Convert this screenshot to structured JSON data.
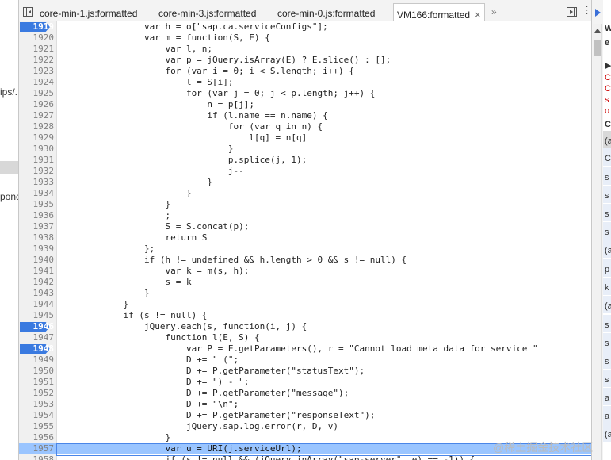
{
  "navigator": {
    "fragments": [
      "ips/.",
      "pone"
    ]
  },
  "tabs": [
    {
      "label": "core-min-1.js:formatted",
      "active": false
    },
    {
      "label": "core-min-3.js:formatted",
      "active": false
    },
    {
      "label": "core-min-0.js:formatted",
      "active": false
    },
    {
      "label": "VM166:formatted",
      "active": true
    }
  ],
  "tab_close_glyph": "×",
  "tab_overflow_glyph": "»",
  "sidebar_more_glyph": "⋮",
  "editor": {
    "breakpoint_lines": [
      "1919",
      "1946",
      "1948"
    ],
    "current_line": "1957",
    "lines": [
      {
        "n": "1919",
        "code": "                var h = o[\"sap.ca.serviceConfigs\"];"
      },
      {
        "n": "1920",
        "code": "                var m = function(S, E) {"
      },
      {
        "n": "1921",
        "code": "                    var l, n;"
      },
      {
        "n": "1922",
        "code": "                    var p = jQuery.isArray(E) ? E.slice() : [];"
      },
      {
        "n": "1923",
        "code": "                    for (var i = 0; i < S.length; i++) {"
      },
      {
        "n": "1924",
        "code": "                        l = S[i];"
      },
      {
        "n": "1925",
        "code": "                        for (var j = 0; j < p.length; j++) {"
      },
      {
        "n": "1926",
        "code": "                            n = p[j];"
      },
      {
        "n": "1927",
        "code": "                            if (l.name == n.name) {"
      },
      {
        "n": "1928",
        "code": "                                for (var q in n) {"
      },
      {
        "n": "1929",
        "code": "                                    l[q] = n[q]"
      },
      {
        "n": "1930",
        "code": "                                }"
      },
      {
        "n": "1931",
        "code": "                                p.splice(j, 1);"
      },
      {
        "n": "1932",
        "code": "                                j--"
      },
      {
        "n": "1933",
        "code": "                            }"
      },
      {
        "n": "1934",
        "code": "                        }"
      },
      {
        "n": "1935",
        "code": "                    }"
      },
      {
        "n": "1936",
        "code": "                    ;"
      },
      {
        "n": "1937",
        "code": "                    S = S.concat(p);"
      },
      {
        "n": "1938",
        "code": "                    return S"
      },
      {
        "n": "1939",
        "code": "                };"
      },
      {
        "n": "1940",
        "code": "                if (h != undefined && h.length > 0 && s != null) {"
      },
      {
        "n": "1941",
        "code": "                    var k = m(s, h);"
      },
      {
        "n": "1942",
        "code": "                    s = k"
      },
      {
        "n": "1943",
        "code": "                }"
      },
      {
        "n": "1944",
        "code": "            }"
      },
      {
        "n": "1945",
        "code": "            if (s != null) {"
      },
      {
        "n": "1946",
        "code": "                jQuery.each(s, function(i, j) {"
      },
      {
        "n": "1947",
        "code": "                    function l(E, S) {"
      },
      {
        "n": "1948",
        "code": "                        var P = E.getParameters(), r = \"Cannot load meta data for service \""
      },
      {
        "n": "1949",
        "code": "                        D += \" (\";"
      },
      {
        "n": "1950",
        "code": "                        D += P.getParameter(\"statusText\");"
      },
      {
        "n": "1951",
        "code": "                        D += \") - \";"
      },
      {
        "n": "1952",
        "code": "                        D += P.getParameter(\"message\");"
      },
      {
        "n": "1953",
        "code": "                        D += \"\\n\";"
      },
      {
        "n": "1954",
        "code": "                        D += P.getParameter(\"responseText\");"
      },
      {
        "n": "1955",
        "code": "                        jQuery.sap.log.error(r, D, v)"
      },
      {
        "n": "1956",
        "code": "                    }"
      },
      {
        "n": "1957",
        "code": "                    var u = URI(j.serviceUrl);"
      },
      {
        "n": "1958",
        "code": "                    if (s != null && (jQuery.inArray(\"sap-server\", e) == -1)) {"
      }
    ]
  },
  "sidebar": {
    "fragments": [
      {
        "text": "W",
        "red": false,
        "hdr": true
      },
      {
        "text": "e",
        "red": false,
        "hdr": true
      },
      {
        "text": "▶",
        "red": false,
        "hdr": false
      },
      {
        "text": "C",
        "red": true,
        "hdr": false
      },
      {
        "text": "C",
        "red": true,
        "hdr": false
      },
      {
        "text": "s",
        "red": true,
        "hdr": false
      },
      {
        "text": "o",
        "red": true,
        "hdr": false
      },
      {
        "text": "C",
        "red": false,
        "hdr": true
      },
      {
        "text": "(a",
        "red": false,
        "hdr": false
      },
      {
        "text": "C",
        "red": false,
        "hdr": false
      },
      {
        "text": "s",
        "red": false,
        "hdr": false
      },
      {
        "text": "s",
        "red": false,
        "hdr": false
      },
      {
        "text": "s",
        "red": false,
        "hdr": false
      },
      {
        "text": "s",
        "red": false,
        "hdr": false
      },
      {
        "text": "(a",
        "red": false,
        "hdr": false
      },
      {
        "text": "p",
        "red": false,
        "hdr": false
      },
      {
        "text": "k",
        "red": false,
        "hdr": false
      },
      {
        "text": "(a",
        "red": false,
        "hdr": false
      },
      {
        "text": "s",
        "red": false,
        "hdr": false
      },
      {
        "text": "s",
        "red": false,
        "hdr": false
      },
      {
        "text": "s",
        "red": false,
        "hdr": false
      },
      {
        "text": "s",
        "red": false,
        "hdr": false
      },
      {
        "text": "a",
        "red": false,
        "hdr": false
      },
      {
        "text": "a",
        "red": false,
        "hdr": false
      },
      {
        "text": "(a",
        "red": false,
        "hdr": false
      }
    ]
  },
  "watermark": "@稀土掘金技术社区"
}
